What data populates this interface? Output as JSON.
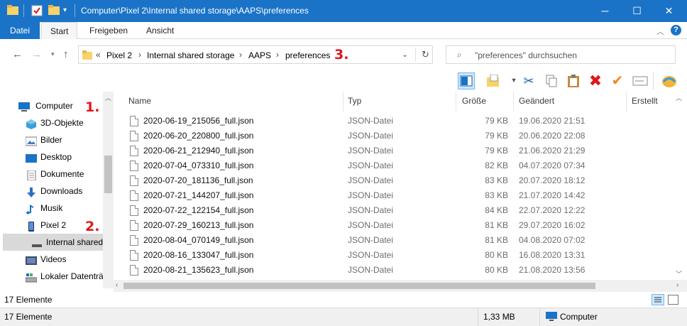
{
  "window": {
    "title": "Computer\\Pixel 2\\Internal shared storage\\AAPS\\preferences",
    "minimize_icon": "minimize-icon",
    "maximize_icon": "maximize-icon",
    "close_icon": "close-icon"
  },
  "ribbon": {
    "tabs": [
      "Datei",
      "Start",
      "Freigeben",
      "Ansicht"
    ],
    "active_tab": "Start"
  },
  "address": {
    "overflow": "«",
    "crumbs": [
      "Pixel 2",
      "Internal shared storage",
      "AAPS",
      "preferences"
    ],
    "search_placeholder": "\"preferences\" durchsuchen"
  },
  "annotations": [
    "1.",
    "2.",
    "3."
  ],
  "sidebar": {
    "items": [
      {
        "label": "Computer",
        "icon": "computer-icon"
      },
      {
        "label": "3D-Objekte",
        "icon": "3d-objects-icon"
      },
      {
        "label": "Bilder",
        "icon": "pictures-icon"
      },
      {
        "label": "Desktop",
        "icon": "desktop-icon"
      },
      {
        "label": "Dokumente",
        "icon": "documents-icon"
      },
      {
        "label": "Downloads",
        "icon": "downloads-icon"
      },
      {
        "label": "Musik",
        "icon": "music-icon"
      },
      {
        "label": "Pixel 2",
        "icon": "phone-icon"
      },
      {
        "label": "Internal shared",
        "icon": "drive-icon"
      },
      {
        "label": "Videos",
        "icon": "videos-icon"
      },
      {
        "label": "Lokaler Datenträ",
        "icon": "local-drive-icon"
      }
    ],
    "selected": "Internal shared"
  },
  "columns": [
    "Name",
    "Typ",
    "Größe",
    "Geändert",
    "Erstellt"
  ],
  "files": [
    {
      "name": "2020-06-19_215056_full.json",
      "type": "JSON-Datei",
      "size": "79 KB",
      "modified": "19.06.2020 21:51"
    },
    {
      "name": "2020-06-20_220800_full.json",
      "type": "JSON-Datei",
      "size": "79 KB",
      "modified": "20.06.2020 22:08"
    },
    {
      "name": "2020-06-21_212940_full.json",
      "type": "JSON-Datei",
      "size": "79 KB",
      "modified": "21.06.2020 21:29"
    },
    {
      "name": "2020-07-04_073310_full.json",
      "type": "JSON-Datei",
      "size": "82 KB",
      "modified": "04.07.2020 07:34"
    },
    {
      "name": "2020-07-20_181136_full.json",
      "type": "JSON-Datei",
      "size": "83 KB",
      "modified": "20.07.2020 18:12"
    },
    {
      "name": "2020-07-21_144207_full.json",
      "type": "JSON-Datei",
      "size": "83 KB",
      "modified": "21.07.2020 14:42"
    },
    {
      "name": "2020-07-22_122154_full.json",
      "type": "JSON-Datei",
      "size": "84 KB",
      "modified": "22.07.2020 12:22"
    },
    {
      "name": "2020-07-29_160213_full.json",
      "type": "JSON-Datei",
      "size": "81 KB",
      "modified": "29.07.2020 16:02"
    },
    {
      "name": "2020-08-04_070149_full.json",
      "type": "JSON-Datei",
      "size": "81 KB",
      "modified": "04.08.2020 07:02"
    },
    {
      "name": "2020-08-16_133047_full.json",
      "type": "JSON-Datei",
      "size": "80 KB",
      "modified": "16.08.2020 13:31"
    },
    {
      "name": "2020-08-21_135623_full.json",
      "type": "JSON-Datei",
      "size": "80 KB",
      "modified": "21.08.2020 13:56"
    }
  ],
  "status": {
    "count_top": "17 Elemente",
    "count_bottom": "17 Elemente",
    "total_size": "1,33 MB",
    "location": "Computer"
  },
  "colors": {
    "titlebar": "#1a73c7",
    "selection": "#cce8ff",
    "annotation_red": "#e0161b"
  }
}
